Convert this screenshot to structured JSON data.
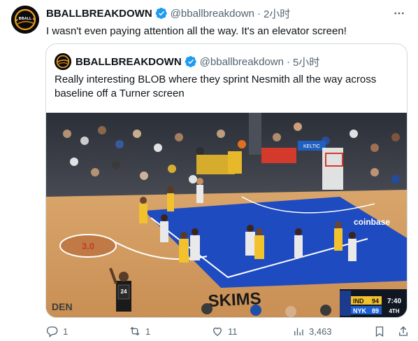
{
  "tweet": {
    "display_name": "BBALLBREAKDOWN",
    "handle": "@bballbreakdown",
    "time": "2小时",
    "text": "I wasn't even paying attention all the way. It's an elevator screen!"
  },
  "quoted": {
    "display_name": "BBALLBREAKDOWN",
    "handle": "@bballbreakdown",
    "time": "5小时",
    "text": "Really interesting BLOB where they sprint Nesmith all the way across baseline off a Turner screen"
  },
  "video_frame": {
    "court_text": "SKIMS",
    "logo_number": "3.0",
    "sponsor": "coinbase",
    "edge_text": "DEN",
    "stanchion": "KELTIC",
    "referee_number": "24",
    "scoreboard": {
      "team1": "IND",
      "score1": "94",
      "team2": "NYK",
      "score2": "89",
      "clock": "7:40",
      "quarter": "4TH"
    }
  },
  "actions": {
    "replies": "1",
    "reposts": "1",
    "likes": "11",
    "views": "3,463"
  },
  "colors": {
    "verified": "#1d9bf0",
    "text_primary": "#0f1419",
    "text_secondary": "#536471",
    "border": "#cfd9de"
  }
}
